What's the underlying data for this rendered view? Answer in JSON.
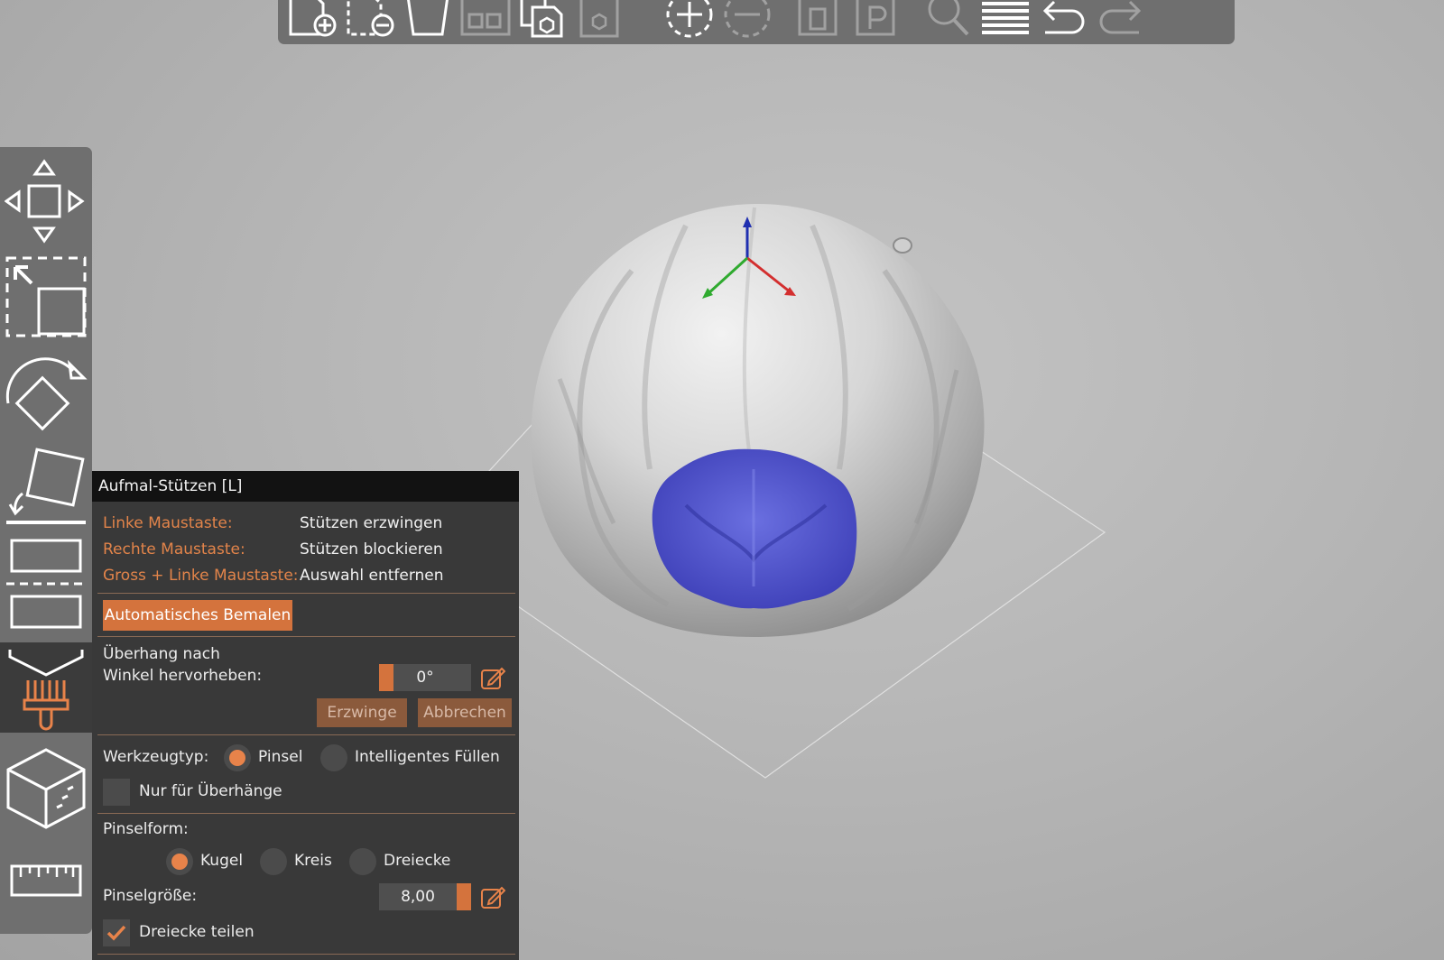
{
  "colors": {
    "accent": "#e2844a",
    "panel_bg": "#393939",
    "toolbar_bg": "#6f6f6f",
    "painted_region": "#4d4fc6",
    "axis_x": "#d32f2f",
    "axis_y": "#2faa2f",
    "axis_z": "#1f2fb0"
  },
  "top_toolbar": {
    "icons": [
      "add-object-icon",
      "remove-object-icon",
      "delete-all-icon",
      "arrange-icon",
      "copy-icon",
      "paste-icon",
      "add-instance-icon",
      "remove-instance-icon",
      "split-objects-icon",
      "split-parts-icon",
      "search-icon",
      "layers-icon",
      "undo-icon",
      "redo-icon"
    ]
  },
  "left_toolbar": {
    "icons": [
      "move-icon",
      "scale-icon",
      "rotate-icon",
      "place-on-face-icon",
      "cut-icon",
      "support-paint-icon",
      "seam-paint-icon",
      "measure-icon"
    ],
    "active": "support-paint-icon"
  },
  "panel": {
    "title": "Aufmal-Stützen [L]",
    "shortcuts": [
      {
        "key": "Linke Maustaste:",
        "action": "Stützen erzwingen"
      },
      {
        "key": "Rechte Maustaste:",
        "action": "Stützen blockieren"
      },
      {
        "key": "Gross + Linke Maustaste:",
        "action": "Auswahl entfernen"
      }
    ],
    "auto_paint_label": "Automatisches Bemalen",
    "overhang_label_line1": "Überhang nach",
    "overhang_label_line2": "Winkel hervorheben:",
    "overhang_value": "0°",
    "enforce_label": "Erzwinge",
    "cancel_label": "Abbrechen",
    "tool_type_label": "Werkzeugtyp:",
    "tool_brush_label": "Pinsel",
    "tool_smart_fill_label": "Intelligentes Füllen",
    "tool_type_selected": "Pinsel",
    "overhangs_only_label": "Nur für Überhänge",
    "overhangs_only_checked": false,
    "brush_shape_label": "Pinselform:",
    "brush_shapes": [
      "Kugel",
      "Kreis",
      "Dreiecke"
    ],
    "brush_shape_selected": "Kugel",
    "brush_size_label": "Pinselgröße:",
    "brush_size_value": "8,00",
    "split_triangles_label": "Dreiecke teilen",
    "split_triangles_checked": true
  }
}
